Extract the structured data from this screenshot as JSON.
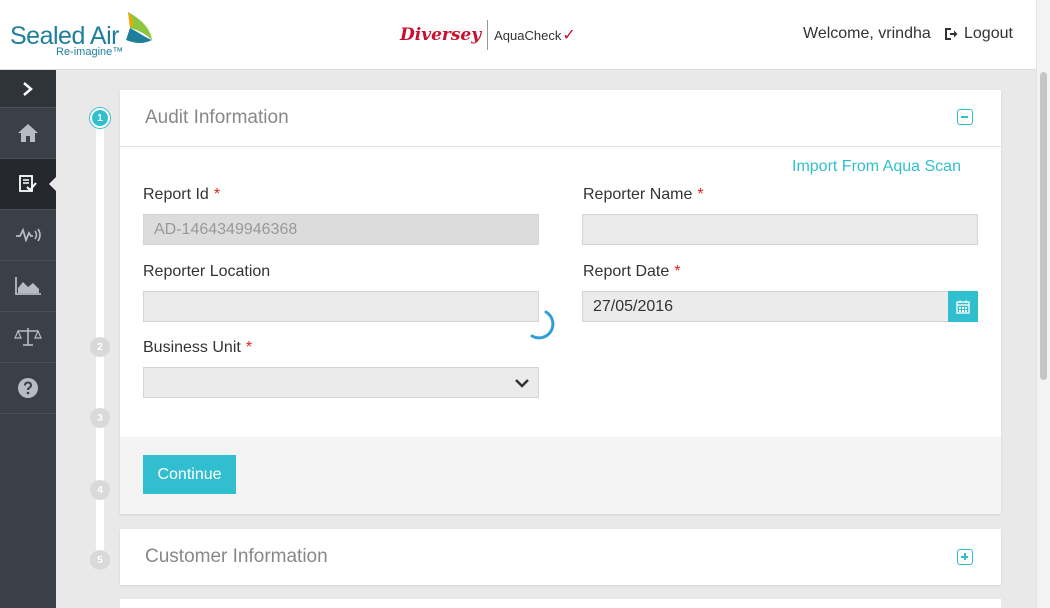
{
  "header": {
    "logo_name": "Sealed Air",
    "logo_tagline": "Re-imagine™",
    "brand_left": "Diversey",
    "brand_right": "AquaCheck",
    "brand_check": "✓",
    "welcome": "Welcome, vrindha",
    "logout": "Logout"
  },
  "sidebar": {
    "items": [
      {
        "icon": "chevron-right-icon"
      },
      {
        "icon": "home-icon"
      },
      {
        "icon": "audit-list-icon",
        "active": true
      },
      {
        "icon": "pulse-icon"
      },
      {
        "icon": "area-chart-icon"
      },
      {
        "icon": "balance-scale-icon"
      },
      {
        "icon": "help-icon"
      }
    ]
  },
  "steps": [
    "1",
    "2",
    "3",
    "4",
    "5"
  ],
  "audit": {
    "title": "Audit Information",
    "import_link": "Import From Aqua Scan",
    "report_id_label": "Report Id",
    "report_id_value": "AD-1464349946368",
    "reporter_name_label": "Reporter Name",
    "reporter_name_value": "",
    "reporter_location_label": "Reporter Location",
    "reporter_location_value": "",
    "report_date_label": "Report Date",
    "report_date_value": "27/05/2016",
    "business_unit_label": "Business Unit",
    "business_unit_value": "",
    "required_mark": "*",
    "continue": "Continue"
  },
  "customer": {
    "title": "Customer Information"
  },
  "colors": {
    "accent": "#31bfcf",
    "required": "#e2231a",
    "sidebar": "#3a4047",
    "brand_red": "#c8102e"
  }
}
